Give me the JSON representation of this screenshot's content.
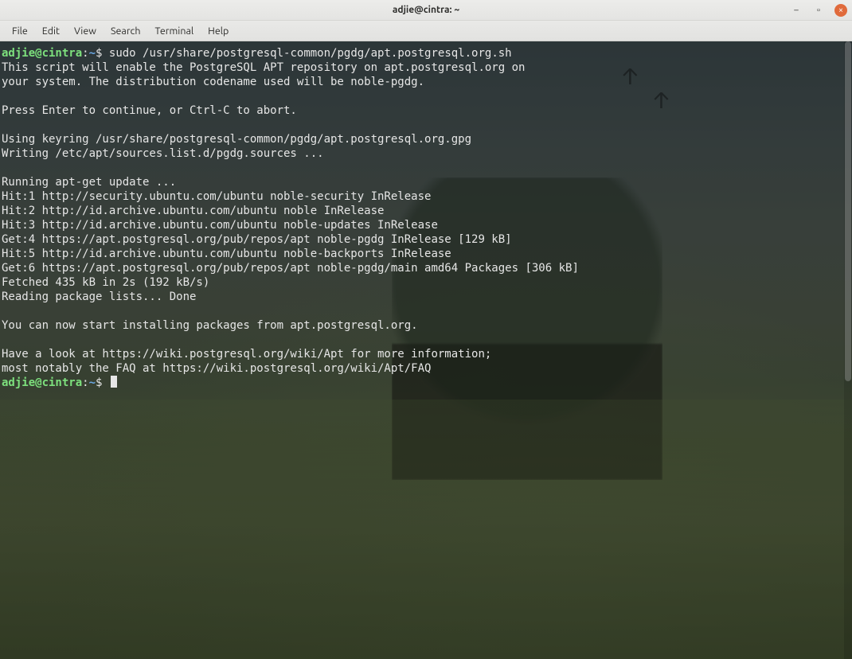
{
  "window": {
    "title": "adjie@cintra: ~"
  },
  "menu": {
    "items": [
      "File",
      "Edit",
      "View",
      "Search",
      "Terminal",
      "Help"
    ]
  },
  "prompt": {
    "user_host": "adjie@cintra",
    "separator": ":",
    "path": "~",
    "symbol": "$"
  },
  "terminal": {
    "command": "sudo /usr/share/postgresql-common/pgdg/apt.postgresql.org.sh",
    "output_lines": [
      "This script will enable the PostgreSQL APT repository on apt.postgresql.org on",
      "your system. The distribution codename used will be noble-pgdg.",
      "",
      "Press Enter to continue, or Ctrl-C to abort.",
      "",
      "Using keyring /usr/share/postgresql-common/pgdg/apt.postgresql.org.gpg",
      "Writing /etc/apt/sources.list.d/pgdg.sources ...",
      "",
      "Running apt-get update ...",
      "Hit:1 http://security.ubuntu.com/ubuntu noble-security InRelease",
      "Hit:2 http://id.archive.ubuntu.com/ubuntu noble InRelease",
      "Hit:3 http://id.archive.ubuntu.com/ubuntu noble-updates InRelease",
      "Get:4 https://apt.postgresql.org/pub/repos/apt noble-pgdg InRelease [129 kB]",
      "Hit:5 http://id.archive.ubuntu.com/ubuntu noble-backports InRelease",
      "Get:6 https://apt.postgresql.org/pub/repos/apt noble-pgdg/main amd64 Packages [306 kB]",
      "Fetched 435 kB in 2s (192 kB/s)",
      "Reading package lists... Done",
      "",
      "You can now start installing packages from apt.postgresql.org.",
      "",
      "Have a look at https://wiki.postgresql.org/wiki/Apt for more information;",
      "most notably the FAQ at https://wiki.postgresql.org/wiki/Apt/FAQ"
    ]
  },
  "icons": {
    "minimize": "–",
    "maximize": "▫",
    "close": "×"
  }
}
